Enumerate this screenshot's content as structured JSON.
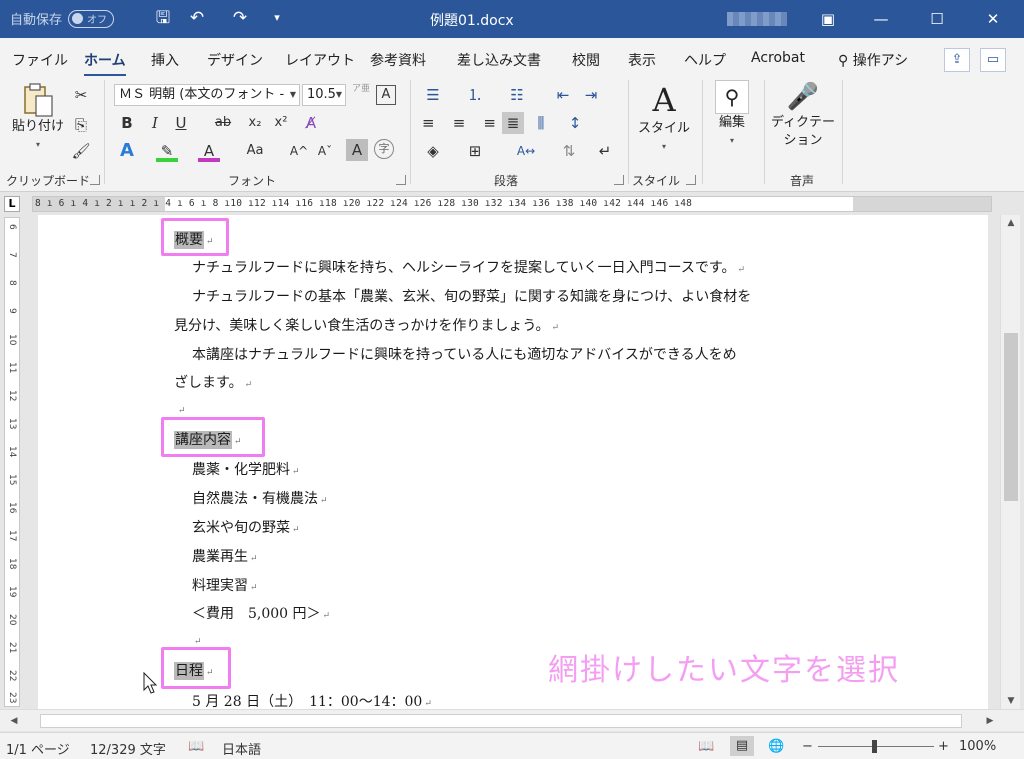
{
  "titlebar": {
    "autosave_label": "自動保存",
    "autosave_state": "オフ",
    "document_title": "例題01.docx",
    "save_glyph": "🖫",
    "undo_glyph": "↶",
    "redo_glyph": "↷",
    "customize_glyph": "▾",
    "ribbon_options_glyph": "▣",
    "minimize_glyph": "—",
    "maximize_glyph": "☐",
    "close_glyph": "✕"
  },
  "tabs": [
    "ファイル",
    "ホーム",
    "挿入",
    "デザイン",
    "レイアウト",
    "参考資料",
    "差し込み文書",
    "校閲",
    "表示",
    "ヘルプ",
    "Acrobat",
    "操作アシ"
  ],
  "tabs_active": "ホーム",
  "tabs_search_glyph": "⚲",
  "tabs_share_glyph": "⇪",
  "tabs_comment_glyph": "▭",
  "ribbon": {
    "clipboard": {
      "paste_label": "貼り付け",
      "cut_glyph": "✂",
      "copy_glyph": "⎘",
      "format_painter_glyph": "🖌",
      "group_label": "クリップボード"
    },
    "font": {
      "font_name": "ＭＳ 明朝 (本文のフォント -",
      "font_size": "10.5",
      "bold": "B",
      "italic": "I",
      "underline": "U",
      "strikethrough": "ab",
      "subscript": "x₂",
      "superscript": "x²",
      "clear_format_glyph": "A̸",
      "text_effects": "A",
      "highlight_glyph": "✎",
      "font_color": "A",
      "change_case": "Aa",
      "grow_font": "A^",
      "shrink_font": "Aˇ",
      "char_shading": "A",
      "enclose_char": "字",
      "phonetic_guide": "ア亜",
      "char_border": "A",
      "group_label": "フォント"
    },
    "paragraph": {
      "bullets_glyph": "☰",
      "numbering_glyph": "⒈",
      "multilevel_glyph": "☷",
      "decrease_indent_glyph": "⇤",
      "increase_indent_glyph": "⇥",
      "align_left_glyph": "≡",
      "align_center_glyph": "≡",
      "align_right_glyph": "≡",
      "justify_glyph": "≣",
      "distributed_glyph": "⫼",
      "line_spacing_glyph": "↕",
      "shading_glyph": "◈",
      "borders_glyph": "⊞",
      "asian_layout_glyph": "A↔",
      "sort_glyph": "⇅",
      "show_marks_glyph": "↵",
      "group_label": "段落"
    },
    "styles": {
      "label": "スタイル",
      "group_label": "スタイル",
      "glyph": "A"
    },
    "editing": {
      "label": "編集",
      "glyph": "⚲"
    },
    "voice": {
      "label_line1": "ディクテー",
      "label_line2": "ション",
      "group_label": "音声",
      "glyph": "🎤"
    }
  },
  "ruler": {
    "corner": "L",
    "ticks": "8 ı 6 ı 4 ı 2 ı   ı 2 ı 4 ı 6 ı 8 ı10 ı12 ı14 ı16 ı18 ı20 ı22 ı24 ı26 ı28 ı30 ı32 ı34 ı36 ı38 ı40 ı42 ı44 ı46 ı48"
  },
  "vruler": [
    "6",
    "7",
    "8",
    "9",
    "10",
    "11",
    "12",
    "13",
    "14",
    "15",
    "16",
    "17",
    "18",
    "19",
    "20",
    "21",
    "22",
    "23"
  ],
  "document": {
    "heading1": "概要",
    "para1": "ナチュラルフードに興味を持ち、ヘルシーライフを提案していく一日入門コースです。",
    "para2a": "ナチュラルフードの基本「農業、玄米、旬の野菜」に関する知識を身につけ、よい食材を",
    "para2b": "見分け、美味しく楽しい食生活のきっかけを作りましょう。",
    "para3a": "本講座はナチュラルフードに興味を持っている人にも適切なアドバイスができる人をめ",
    "para3b": "ざします。",
    "heading2": "講座内容",
    "items": [
      "農薬・化学肥料",
      "自然農法・有機農法",
      "玄米や旬の野菜",
      "農業再生",
      "料理実習",
      "＜費用　5,000 円＞"
    ],
    "heading3": "日程",
    "schedule": "5 月 28 日（土）　11：00〜14：00",
    "return_mark": "↵",
    "annotation": "網掛けしたい文字を選択",
    "highlight_color": "#f07ef0",
    "shade_color": "#b9b9b9"
  },
  "status": {
    "page": "1/1 ページ",
    "words": "12/329 文字",
    "proof_glyph": "📖",
    "language": "日本語",
    "read_mode_glyph": "📖",
    "print_layout_glyph": "▤",
    "web_layout_glyph": "🌐",
    "zoom_minus": "−",
    "zoom_plus": "+",
    "zoom_percent": "100%",
    "zoom_level": 1.0
  },
  "colors": {
    "titlebar": "#2b579a",
    "ribbon": "#f3f3f3",
    "accent": "#2b579a"
  }
}
